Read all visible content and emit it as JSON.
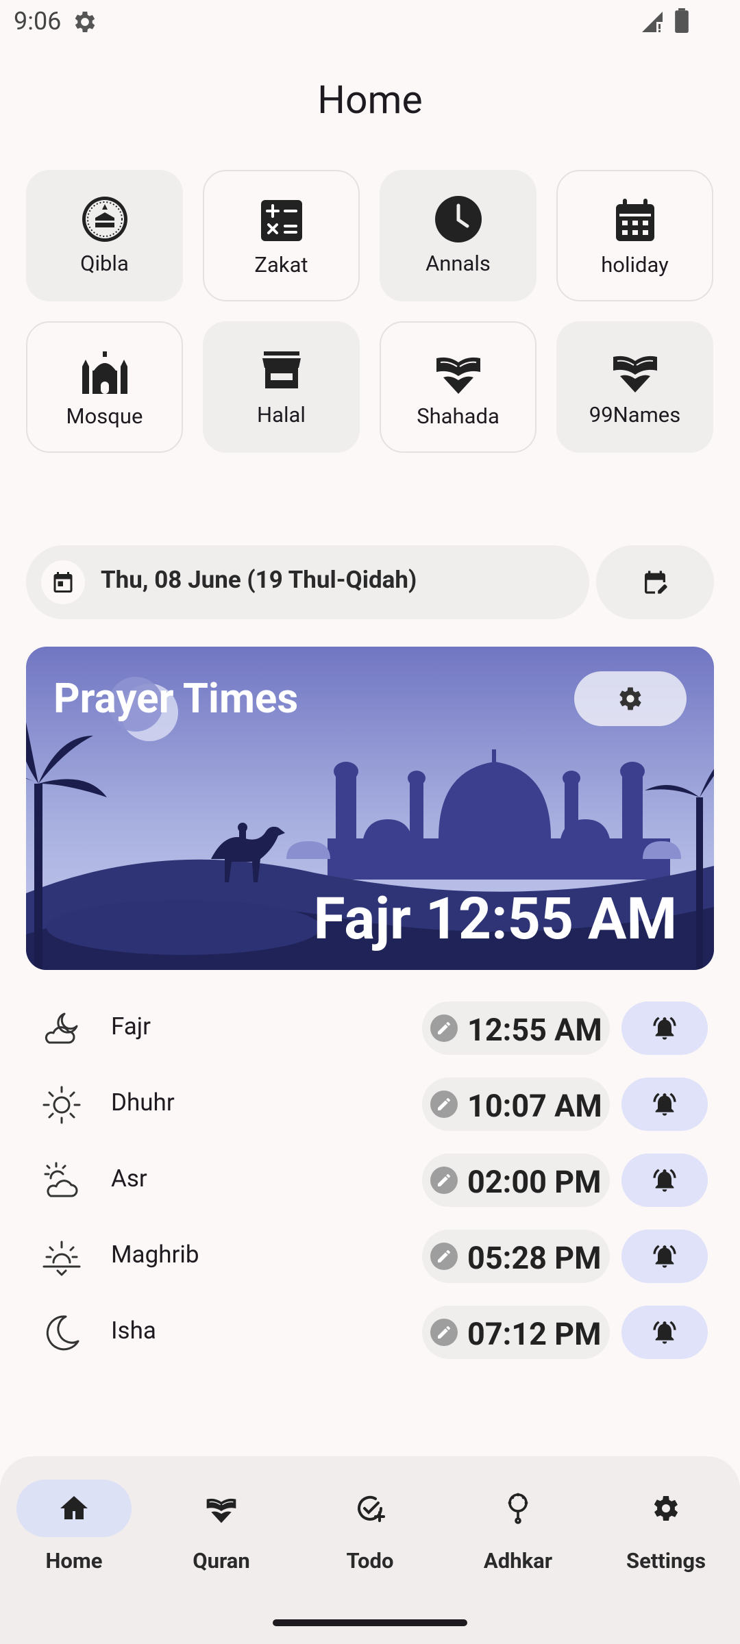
{
  "status_bar": {
    "time": "9:06"
  },
  "page": {
    "title": "Home"
  },
  "grid": [
    {
      "label": "Qibla",
      "icon": "qibla-compass-icon",
      "style": "filled"
    },
    {
      "label": "Zakat",
      "icon": "calculator-icon",
      "style": "outlined"
    },
    {
      "label": "Annals",
      "icon": "clock-icon",
      "style": "filled"
    },
    {
      "label": "holiday",
      "icon": "calendar-icon",
      "style": "outlined"
    },
    {
      "label": "Mosque",
      "icon": "mosque-icon",
      "style": "outlined"
    },
    {
      "label": "Halal",
      "icon": "store-icon",
      "style": "filled"
    },
    {
      "label": "Shahada",
      "icon": "open-book-icon",
      "style": "outlined"
    },
    {
      "label": "99Names",
      "icon": "open-book-icon",
      "style": "filled"
    }
  ],
  "date_bar": {
    "text": "Thu, 08  June (19 Thul-Qidah)"
  },
  "banner": {
    "title": "Prayer Times",
    "next_prayer": "Fajr 12:55 AM"
  },
  "prayers": [
    {
      "name": "Fajr",
      "time": "12:55 AM",
      "icon": "cloud-moon-icon"
    },
    {
      "name": "Dhuhr",
      "time": "10:07 AM",
      "icon": "sun-icon"
    },
    {
      "name": "Asr",
      "time": "02:00 PM",
      "icon": "partly-cloudy-icon"
    },
    {
      "name": "Maghrib",
      "time": "05:28 PM",
      "icon": "sunset-icon"
    },
    {
      "name": "Isha",
      "time": "07:12 PM",
      "icon": "crescent-moon-icon"
    }
  ],
  "nav": [
    {
      "label": "Home",
      "icon": "home-icon",
      "active": true
    },
    {
      "label": "Quran",
      "icon": "quran-book-icon",
      "active": false
    },
    {
      "label": "Todo",
      "icon": "task-add-icon",
      "active": false
    },
    {
      "label": "Adhkar",
      "icon": "prayer-beads-icon",
      "active": false
    },
    {
      "label": "Settings",
      "icon": "gear-icon",
      "active": false
    }
  ],
  "colors": {
    "background": "#fdf8f8",
    "tile_fill": "#f0eded",
    "accent": "#dde1f6",
    "banner_sky": "#7378c4"
  }
}
